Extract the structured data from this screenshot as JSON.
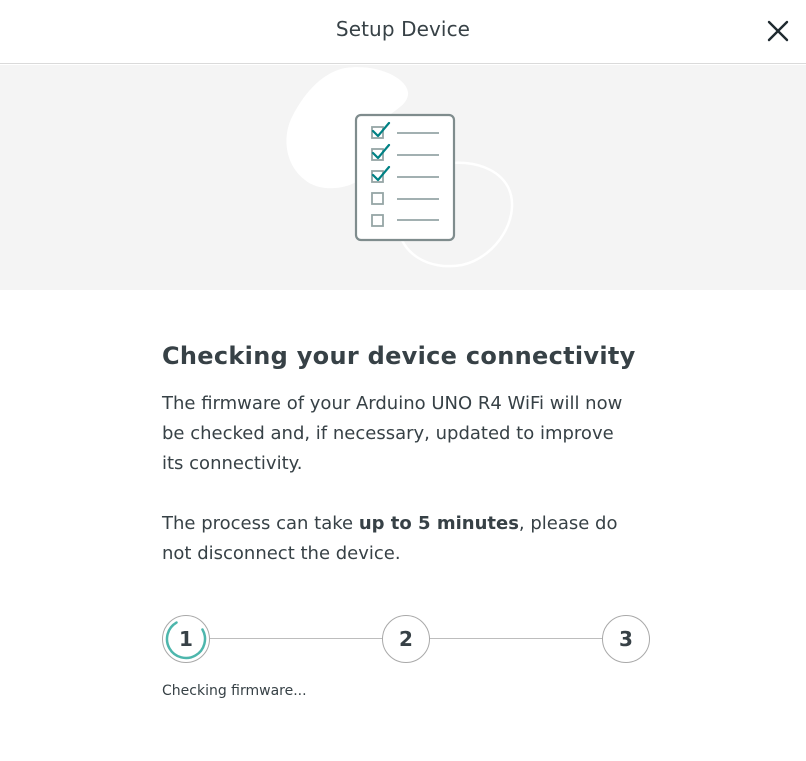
{
  "header": {
    "title": "Setup Device",
    "close_icon": "close-icon"
  },
  "hero": {
    "illustration": "checklist-illustration",
    "accent_color": "#008184"
  },
  "main": {
    "heading": "Checking your device connectivity",
    "paragraph1": "The firmware of your Arduino UNO R4 WiFi will now be checked and, if necessary, updated to improve its connectivity.",
    "paragraph2_prefix": "The process can take ",
    "paragraph2_bold": "up to 5 minutes",
    "paragraph2_suffix": ", please do not disconnect the device."
  },
  "stepper": {
    "steps": [
      {
        "label": "1",
        "state": "in-progress"
      },
      {
        "label": "2",
        "state": "pending"
      },
      {
        "label": "3",
        "state": "pending"
      }
    ],
    "status_text": "Checking firmware..."
  }
}
